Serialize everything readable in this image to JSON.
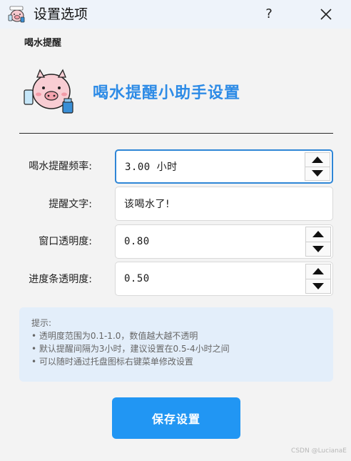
{
  "window": {
    "title": "设置选项",
    "help_label": "?"
  },
  "header": {
    "logo_text": "喝水提醒",
    "headline": "喝水提醒小助手设置"
  },
  "form": {
    "frequency": {
      "label": "喝水提醒频率:",
      "value": "3.00 小时"
    },
    "reminder_text": {
      "label": "提醒文字:",
      "value": "该喝水了!"
    },
    "window_opacity": {
      "label": "窗口透明度:",
      "value": "0.80"
    },
    "progress_opacity": {
      "label": "进度条透明度:",
      "value": "0.50"
    }
  },
  "tips": {
    "title": "提示:",
    "lines": [
      "• 透明度范围为0.1-1.0，数值越大越不透明",
      "• 默认提醒间隔为3小时，建议设置在0.5-4小时之间",
      "• 可以随时通过托盘图标右键菜单修改设置"
    ]
  },
  "actions": {
    "save_label": "保存设置"
  },
  "watermark": "CSDN @LucianaE",
  "colors": {
    "accent": "#2196f3",
    "headline": "#2d8be6",
    "tips_bg": "#e3eefa",
    "focus_border": "#2f86d6"
  },
  "icons": {
    "app": "pig-mascot-icon",
    "close": "close-icon",
    "spin_up": "triangle-up-icon",
    "spin_down": "triangle-down-icon"
  }
}
